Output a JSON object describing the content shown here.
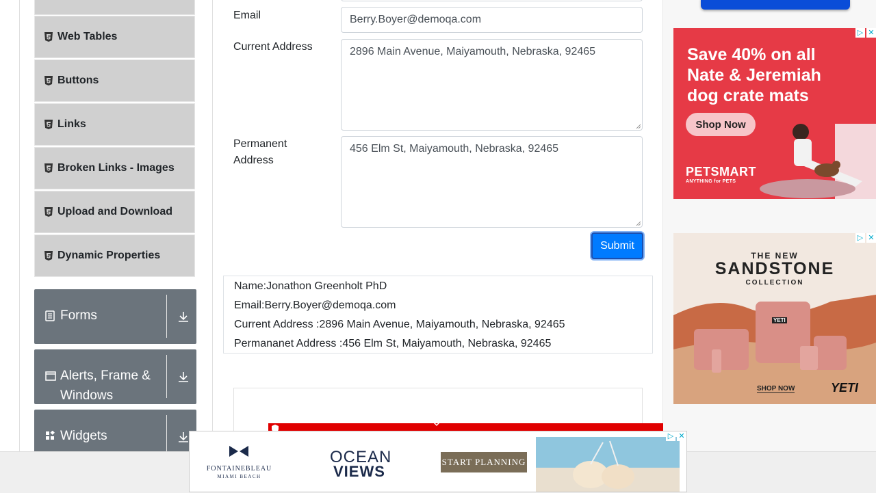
{
  "sidebar": {
    "items": [
      {
        "label": "Web Tables"
      },
      {
        "label": "Buttons"
      },
      {
        "label": "Links"
      },
      {
        "label": "Broken Links - Images"
      },
      {
        "label": "Upload and Download"
      },
      {
        "label": "Dynamic Properties"
      }
    ],
    "groups": [
      {
        "label": "Forms"
      },
      {
        "label": "Alerts, Frame & Windows"
      },
      {
        "label": "Widgets"
      }
    ]
  },
  "form": {
    "email_label": "Email",
    "email_value": "Berry.Boyer@demoqa.com",
    "current_address_label": "Current Address",
    "current_address_value": "2896 Main Avenue, Maiyamouth, Nebraska, 92465",
    "permanent_address_label_1": "Permanent",
    "permanent_address_label_2": "Address",
    "permanent_address_value": "456 Elm St, Maiyamouth, Nebraska, 92465",
    "submit_label": "Submit"
  },
  "output": {
    "name": "Name:Jonathon Greenholt PhD",
    "email": "Email:Berry.Boyer@demoqa.com",
    "current": "Current Address :2896 Main Avenue, Maiyamouth, Nebraska, 92465",
    "permanent": "Permananet Address :456 Elm St, Maiyamouth, Nebraska, 92465"
  },
  "ads": {
    "petsmart": {
      "headline": "Save 40% on all Nate & Jeremiah dog crate mats",
      "cta": "Shop Now",
      "brand": "PETSMART",
      "tagline": "ANYTHING for PETS",
      "color": "#e63a46"
    },
    "yeti": {
      "kicker": "THE NEW",
      "title": "SANDSTONE",
      "subtitle": "COLLECTION",
      "cta": "SHOP NOW",
      "brand": "YETI",
      "product_label": "YETI"
    },
    "banner": {
      "brand": "FONTAINEBLEAU",
      "brand_sub": "MIAMI BEACH",
      "headline_1": "OCEAN",
      "headline_2": "VIEWS",
      "cta": "START PLANNING"
    }
  },
  "colors": {
    "accent": "#007bff",
    "group_bg": "#6b747c",
    "item_bg": "#d0d0d0"
  }
}
